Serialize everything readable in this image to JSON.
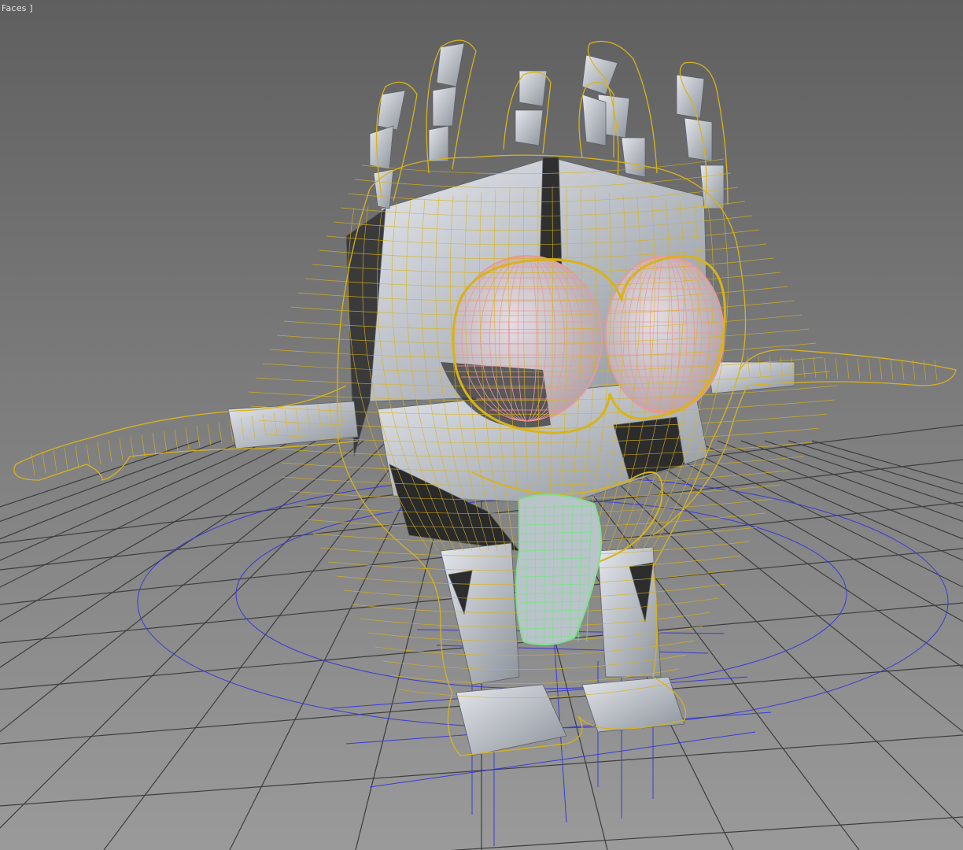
{
  "viewport": {
    "label_prefix": "",
    "label_mode": "Faces",
    "label_suffix": " ]",
    "background_top": "#5f5f5f",
    "background_bottom": "#9a9a9a"
  },
  "colors": {
    "wireframe_selected": "#d8b31a",
    "wireframe_eyes": "#e79a9a",
    "wireframe_tongue": "#7fe08f",
    "bones": "#c8ccd2",
    "bone_dark": "#3a3a3a",
    "grid_lines": "#3d3d3d",
    "helper_lines": "#3a3ad6",
    "eye_fill": "#c9c2c6"
  },
  "scene_objects": [
    {
      "name": "character-mesh",
      "state": "selected"
    },
    {
      "name": "biped-skeleton",
      "state": "visible"
    },
    {
      "name": "eye-left",
      "state": "visible"
    },
    {
      "name": "eye-right",
      "state": "visible"
    },
    {
      "name": "tongue",
      "state": "visible"
    },
    {
      "name": "floor-helper-circle",
      "state": "visible"
    }
  ]
}
